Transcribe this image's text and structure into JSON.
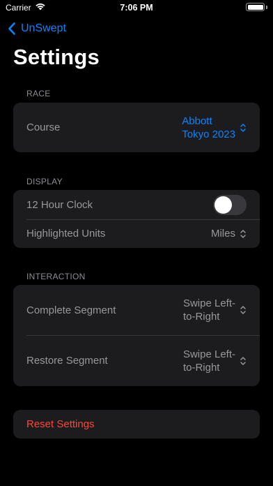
{
  "status_bar": {
    "carrier": "Carrier",
    "time": "7:06 PM",
    "icons": [
      "wifi-icon",
      "battery-icon"
    ]
  },
  "nav": {
    "back_label": "UnSwept",
    "back_icon": "chevron-left-icon"
  },
  "page_title": "Settings",
  "sections": {
    "race": {
      "header": "RACE",
      "course_label": "Course",
      "course_value_line1": "Abbott",
      "course_value_line2": "Tokyo 2023"
    },
    "display": {
      "header": "DISPLAY",
      "clock_label": "12 Hour Clock",
      "clock_enabled": false,
      "units_label": "Highlighted Units",
      "units_value": "Miles"
    },
    "interaction": {
      "header": "INTERACTION",
      "complete_label": "Complete Segment",
      "complete_value_line1": "Swipe Left-",
      "complete_value_line2": "to-Right",
      "restore_label": "Restore Segment",
      "restore_value_line1": "Swipe Left-",
      "restore_value_line2": "to-Right"
    },
    "reset": {
      "label": "Reset Settings"
    }
  },
  "colors": {
    "accent": "#0a84ff",
    "destructive": "#ff453a",
    "group_background": "#1c1c1e",
    "secondary_text": "#98989d"
  }
}
